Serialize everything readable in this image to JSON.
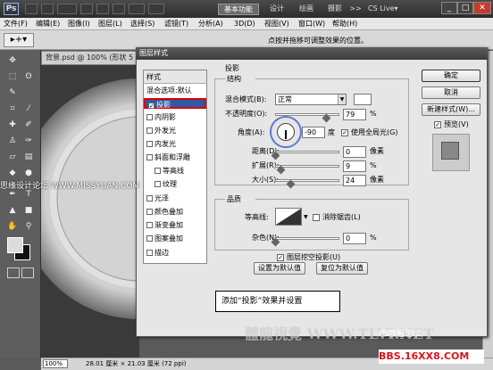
{
  "app": {
    "logo": "Ps",
    "workspaces": [
      "基本功能",
      "设计",
      "绘画",
      "摄影",
      ">>"
    ],
    "cs_live": "CS Live▾",
    "window_controls": [
      "_",
      "□",
      "✕"
    ]
  },
  "menubar": [
    "文件(F)",
    "编辑(E)",
    "图像(I)",
    "图层(L)",
    "选择(S)",
    "滤镜(T)",
    "分析(A)",
    "3D(D)",
    "视图(V)",
    "窗口(W)",
    "帮助(H)"
  ],
  "options": {
    "tool_icon": "▸+▾",
    "hint": "点按并拖移可调整效果的位置。"
  },
  "document": {
    "tab": "背景.psd @ 100% (形状 5",
    "zoom": "100%",
    "size": "28.01 厘米 × 21.03 厘米 (72 ppi)"
  },
  "watermarks": {
    "left": "思缘设计论坛 WWW.MISSYUAN.COM",
    "bottom": "體龍視覺 WWW.TLVI.NET",
    "forum": "PS教程论坛",
    "url": "BBS.16XX8.COM"
  },
  "dialog": {
    "title": "图层样式",
    "styles_header": "样式",
    "styles": [
      {
        "label": "混合选项:默认",
        "checkbox": false,
        "checked": false
      },
      {
        "label": "投影",
        "checkbox": true,
        "checked": true
      },
      {
        "label": "内阴影",
        "checkbox": true,
        "checked": false
      },
      {
        "label": "外发光",
        "checkbox": true,
        "checked": false
      },
      {
        "label": "内发光",
        "checkbox": true,
        "checked": false
      },
      {
        "label": "斜面和浮雕",
        "checkbox": true,
        "checked": false
      },
      {
        "label": "等高线",
        "checkbox": true,
        "checked": false
      },
      {
        "label": "纹理",
        "checkbox": true,
        "checked": false
      },
      {
        "label": "光泽",
        "checkbox": true,
        "checked": false
      },
      {
        "label": "颜色叠加",
        "checkbox": true,
        "checked": false
      },
      {
        "label": "渐变叠加",
        "checkbox": true,
        "checked": false
      },
      {
        "label": "图案叠加",
        "checkbox": true,
        "checked": false
      },
      {
        "label": "描边",
        "checkbox": true,
        "checked": false
      }
    ],
    "section_title": "投影",
    "structure": {
      "title": "结构",
      "blend_mode_label": "混合模式(B):",
      "blend_mode": "正常",
      "opacity_label": "不透明度(O):",
      "opacity": "79",
      "opacity_unit": "%",
      "angle_label": "角度(A):",
      "angle": "-90",
      "angle_unit": "度",
      "global_light_label": "使用全局光(G)",
      "global_light": true,
      "distance_label": "距离(D):",
      "distance": "0",
      "distance_unit": "像素",
      "spread_label": "扩展(R):",
      "spread": "9",
      "spread_unit": "%",
      "size_label": "大小(S):",
      "size": "24",
      "size_unit": "像素"
    },
    "quality": {
      "title": "品质",
      "contour_label": "等高线:",
      "antialias_label": "消除锯齿(L)",
      "noise_label": "杂色(N):",
      "noise": "0",
      "noise_unit": "%"
    },
    "knockout_label": "图层挖空投影(U)",
    "set_default": "设置为默认值",
    "reset_default": "复位为默认值",
    "buttons": {
      "ok": "确定",
      "cancel": "取消",
      "new_style": "新建样式(W)...",
      "preview": "预览(V)"
    },
    "slider_levels": {
      "opacity": 0.79,
      "distance": 0.0,
      "spread": 0.09,
      "size": 0.24,
      "noise": 0.0
    }
  },
  "callout": "添加“投影”效果并设置",
  "colors": {
    "selection": "#2e5aa5",
    "highlight_border": "#dd0000",
    "ring": "#3b5fc8"
  }
}
